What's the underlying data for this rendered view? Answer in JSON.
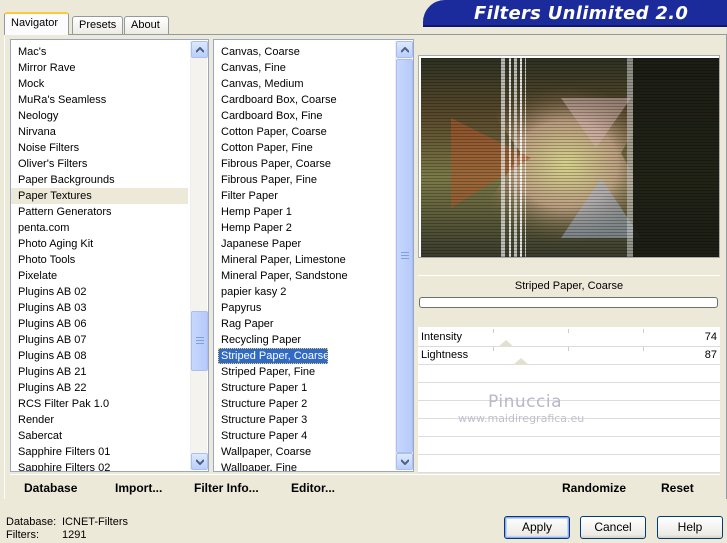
{
  "tabs": [
    {
      "label": "Navigator",
      "active": true
    },
    {
      "label": "Presets",
      "active": false
    },
    {
      "label": "About",
      "active": false
    }
  ],
  "header": {
    "title": "Filters Unlimited 2.0"
  },
  "categories": {
    "items": [
      "Mac's",
      "Mirror Rave",
      "Mock",
      "MuRa's Seamless",
      "Neology",
      "Nirvana",
      "Noise Filters",
      "Oliver's Filters",
      "Paper Backgrounds",
      "Paper Textures",
      "Pattern Generators",
      "penta.com",
      "Photo Aging Kit",
      "Photo Tools",
      "Pixelate",
      "Plugins AB 02",
      "Plugins AB 03",
      "Plugins AB 06",
      "Plugins AB 07",
      "Plugins AB 08",
      "Plugins AB 21",
      "Plugins AB 22",
      "RCS Filter Pak 1.0",
      "Render",
      "Sabercat",
      "Sapphire Filters 01",
      "Sapphire Filters 02"
    ],
    "selected": "Paper Textures"
  },
  "filters": {
    "items": [
      "Canvas, Coarse",
      "Canvas, Fine",
      "Canvas, Medium",
      "Cardboard Box, Coarse",
      "Cardboard Box, Fine",
      "Cotton Paper, Coarse",
      "Cotton Paper, Fine",
      "Fibrous Paper, Coarse",
      "Fibrous Paper, Fine",
      "Filter Paper",
      "Hemp Paper 1",
      "Hemp Paper 2",
      "Japanese Paper",
      "Mineral Paper, Limestone",
      "Mineral Paper, Sandstone",
      "papier kasy 2",
      "Papyrus",
      "Rag Paper",
      "Recycling Paper",
      "Striped Paper, Coarse",
      "Striped Paper, Fine",
      "Structure Paper 1",
      "Structure Paper 2",
      "Structure Paper 3",
      "Structure Paper 4",
      "Wallpaper, Coarse",
      "Wallpaper, Fine"
    ],
    "selected": "Striped Paper, Coarse"
  },
  "preview": {
    "filter_name": "Striped Paper, Coarse",
    "progress": 0
  },
  "sliders": [
    {
      "label": "Intensity",
      "value": "74",
      "fraction": 0.29
    },
    {
      "label": "Lightness",
      "value": "87",
      "fraction": 0.34
    }
  ],
  "watermark": {
    "title": "Pinuccia",
    "subtitle": "www.maidiregrafica.eu"
  },
  "toolbar": {
    "database": "Database",
    "import": "Import...",
    "filter_info": "Filter Info...",
    "editor": "Editor...",
    "randomize": "Randomize",
    "reset": "Reset"
  },
  "footer": {
    "database_label": "Database:",
    "database_value": "ICNET-Filters",
    "filters_label": "Filters:",
    "filters_value": "1291",
    "apply": "Apply",
    "cancel": "Cancel",
    "help": "Help"
  },
  "colors": {
    "selection": "#316ac5",
    "banner": "#1c2b9c",
    "face": "#ece9d8"
  }
}
